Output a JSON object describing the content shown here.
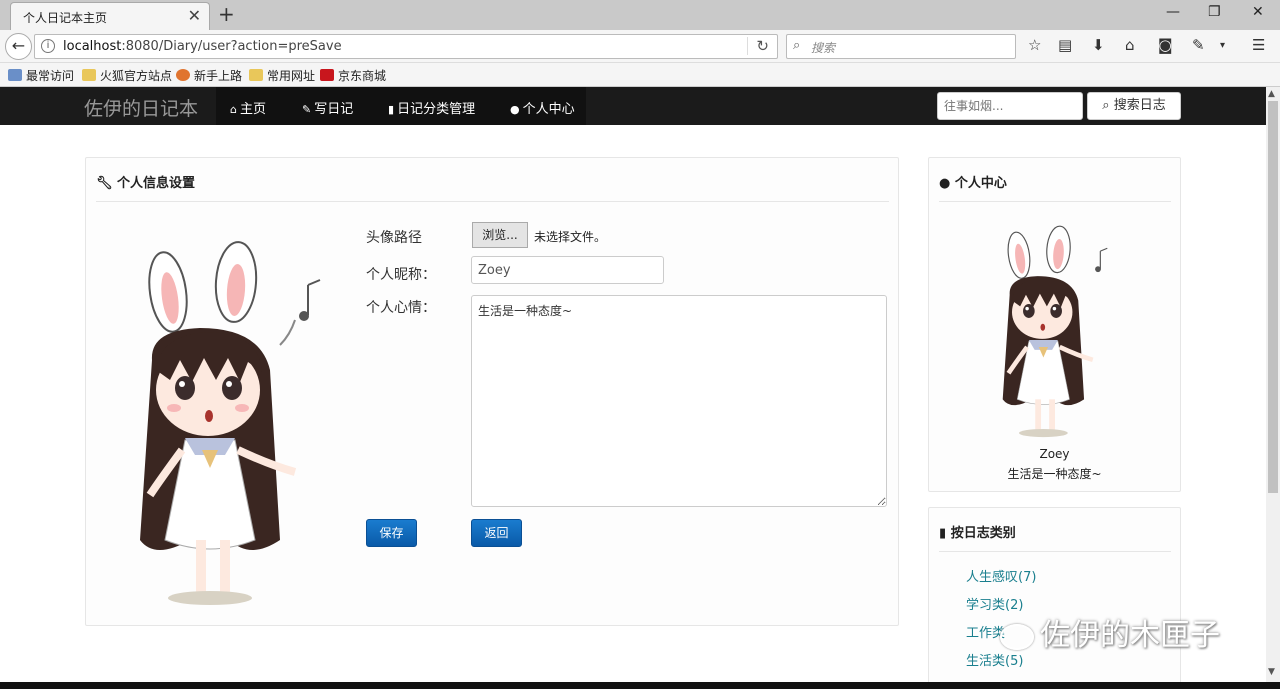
{
  "browser": {
    "tab_title": "个人日记本主页",
    "url_host": "localhost",
    "url_rest": ":8080/Diary/user?action=preSave",
    "search_placeholder": "搜索",
    "bookmarks": [
      "最常访问",
      "火狐官方站点",
      "新手上路",
      "常用网址",
      "京东商城"
    ]
  },
  "navbar": {
    "brand": "佐伊的日记本",
    "items": [
      {
        "label": "主页",
        "icon": "home-icon"
      },
      {
        "label": "写日记",
        "icon": "pencil-icon"
      },
      {
        "label": "日记分类管理",
        "icon": "book-icon"
      },
      {
        "label": "个人中心",
        "icon": "user-icon"
      }
    ],
    "search_placeholder": "往事如烟...",
    "search_button": "搜索日志"
  },
  "settings": {
    "title": "个人信息设置",
    "avatar_label": "头像路径",
    "browse_button": "浏览...",
    "file_status": "未选择文件。",
    "nickname_label": "个人昵称：",
    "nickname_value": "Zoey",
    "mood_label": "个人心情：",
    "mood_value": "生活是一种态度~",
    "save_button": "保存",
    "back_button": "返回"
  },
  "profile": {
    "title": "个人中心",
    "name": "Zoey",
    "mood": "生活是一种态度~"
  },
  "categories": {
    "title": "按日志类别",
    "items": [
      "人生感叹(7)",
      "学习类(2)",
      "工作类",
      "生活类(5)"
    ]
  },
  "watermark": "佐伊的木匣子",
  "colors": {
    "navbar_bg": "#1b1b1b",
    "primary_button": "#0a66c2",
    "link": "#1a7f8e"
  }
}
